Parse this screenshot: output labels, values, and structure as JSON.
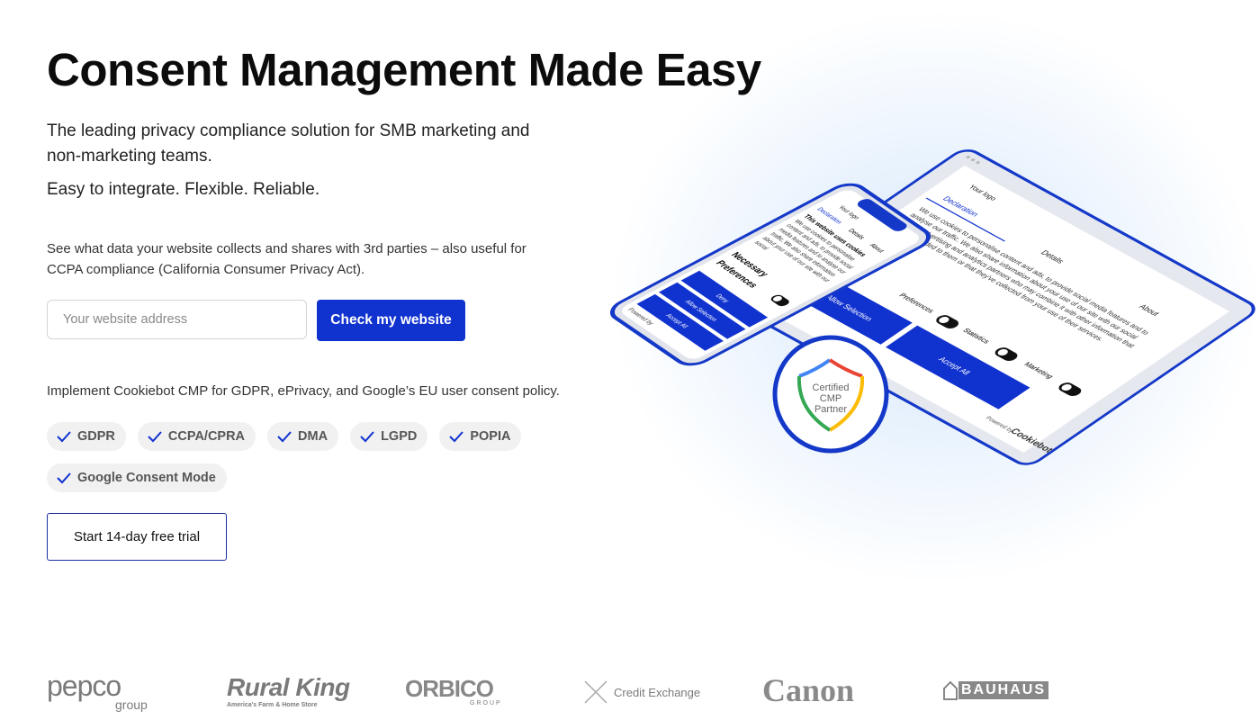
{
  "hero": {
    "title": "Consent Management Made Easy",
    "subtitle": "The leading privacy compliance solution for SMB marketing and non-marketing teams.",
    "tagline": "Easy to integrate. Flexible. Reliable.",
    "description": "See what data your website collects and shares with 3rd parties – also useful for CCPA compliance (California Consumer Privacy Act).",
    "url_placeholder": "Your website address",
    "check_button": "Check my website",
    "implement_text": "Implement Cookiebot CMP for GDPR, ePrivacy, and Google’s EU user consent policy.",
    "chips": [
      "GDPR",
      "CCPA/CPRA",
      "DMA",
      "LGPD",
      "POPIA",
      "Google Consent Mode"
    ],
    "trial_button": "Start 14-day free trial"
  },
  "illustration": {
    "phone": {
      "tabs": [
        "Declaration",
        "Details",
        "About"
      ],
      "logo": "Your logo",
      "heading": "This website uses cookies",
      "body": "We use cookies to personalise content and ads, to provide social media features and to analyse our traffic. We also share information about your use of our site with our social",
      "categories": [
        "Necessary",
        "Preferences"
      ],
      "buttons": [
        "Deny",
        "Allow Selection",
        "Accept All"
      ],
      "powered": "Powered by"
    },
    "tablet": {
      "logo": "Your logo",
      "tabs": [
        "Declaration",
        "Details",
        "About"
      ],
      "body": "We use cookies to personalise content and ads, to provide social media features and to analyse our traffic. We also share information about your use of our site with our social media, advertising and analytics partners who may combine it with other information that you've provided to them or that they've collected from your use of their services.",
      "categories": [
        "Preferences",
        "Statistics",
        "Marketing"
      ],
      "buttons": [
        "Allow Selection",
        "Accept All"
      ],
      "powered": "Powered by",
      "brand": "Cookiebot"
    },
    "badge": [
      "Certified",
      "CMP",
      "Partner"
    ]
  },
  "colors": {
    "accent": "#1032cf",
    "badge_blue": "#4285f4",
    "badge_red": "#ea4335",
    "badge_yellow": "#fbbc05",
    "badge_green": "#34a853"
  },
  "logos": [
    {
      "name": "pepco",
      "sub": "group"
    },
    {
      "name": "Rural King",
      "sub": "America's Farm & Home Store"
    },
    {
      "name": "ORBICO",
      "sub": "GROUP"
    },
    {
      "name": "Credit Exchange"
    },
    {
      "name": "Canon"
    },
    {
      "name": "BAUHAUS"
    }
  ]
}
